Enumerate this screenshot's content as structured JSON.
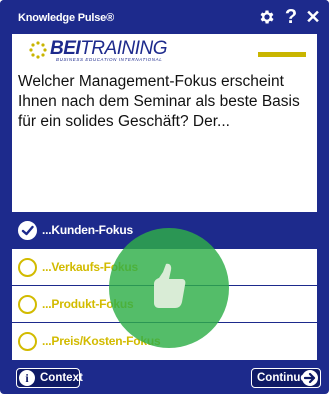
{
  "window": {
    "title": "Knowledge Pulse®",
    "controls": {
      "settings_icon": "gear-icon",
      "help_label": "?",
      "close_label": "✕"
    }
  },
  "brand": {
    "logo_text_bold": "BEI",
    "logo_text_light": "TRAINING",
    "logo_tagline": "BUSINESS EDUCATION INTERNATIONAL",
    "accent_color": "#c9b500",
    "primary_color": "#1d2a8c"
  },
  "question": {
    "text": "Welcher Management-Fokus erscheint Ihnen nach dem Seminar als beste Basis für ein solides Geschäft? Der..."
  },
  "answers": [
    {
      "label": "...Kunden-Fokus",
      "selected": true
    },
    {
      "label": "...Verkaufs-Fokus",
      "selected": false
    },
    {
      "label": "...Produkt-Fokus",
      "selected": false
    },
    {
      "label": "...Preis/Kosten-Fokus",
      "selected": false
    }
  ],
  "feedback": {
    "icon": "thumbs-up-icon",
    "color": "#2eaf48"
  },
  "footer": {
    "context_label": "Context",
    "context_icon": "info-icon",
    "continue_label": "Continue",
    "continue_icon": "arrow-right-icon"
  }
}
